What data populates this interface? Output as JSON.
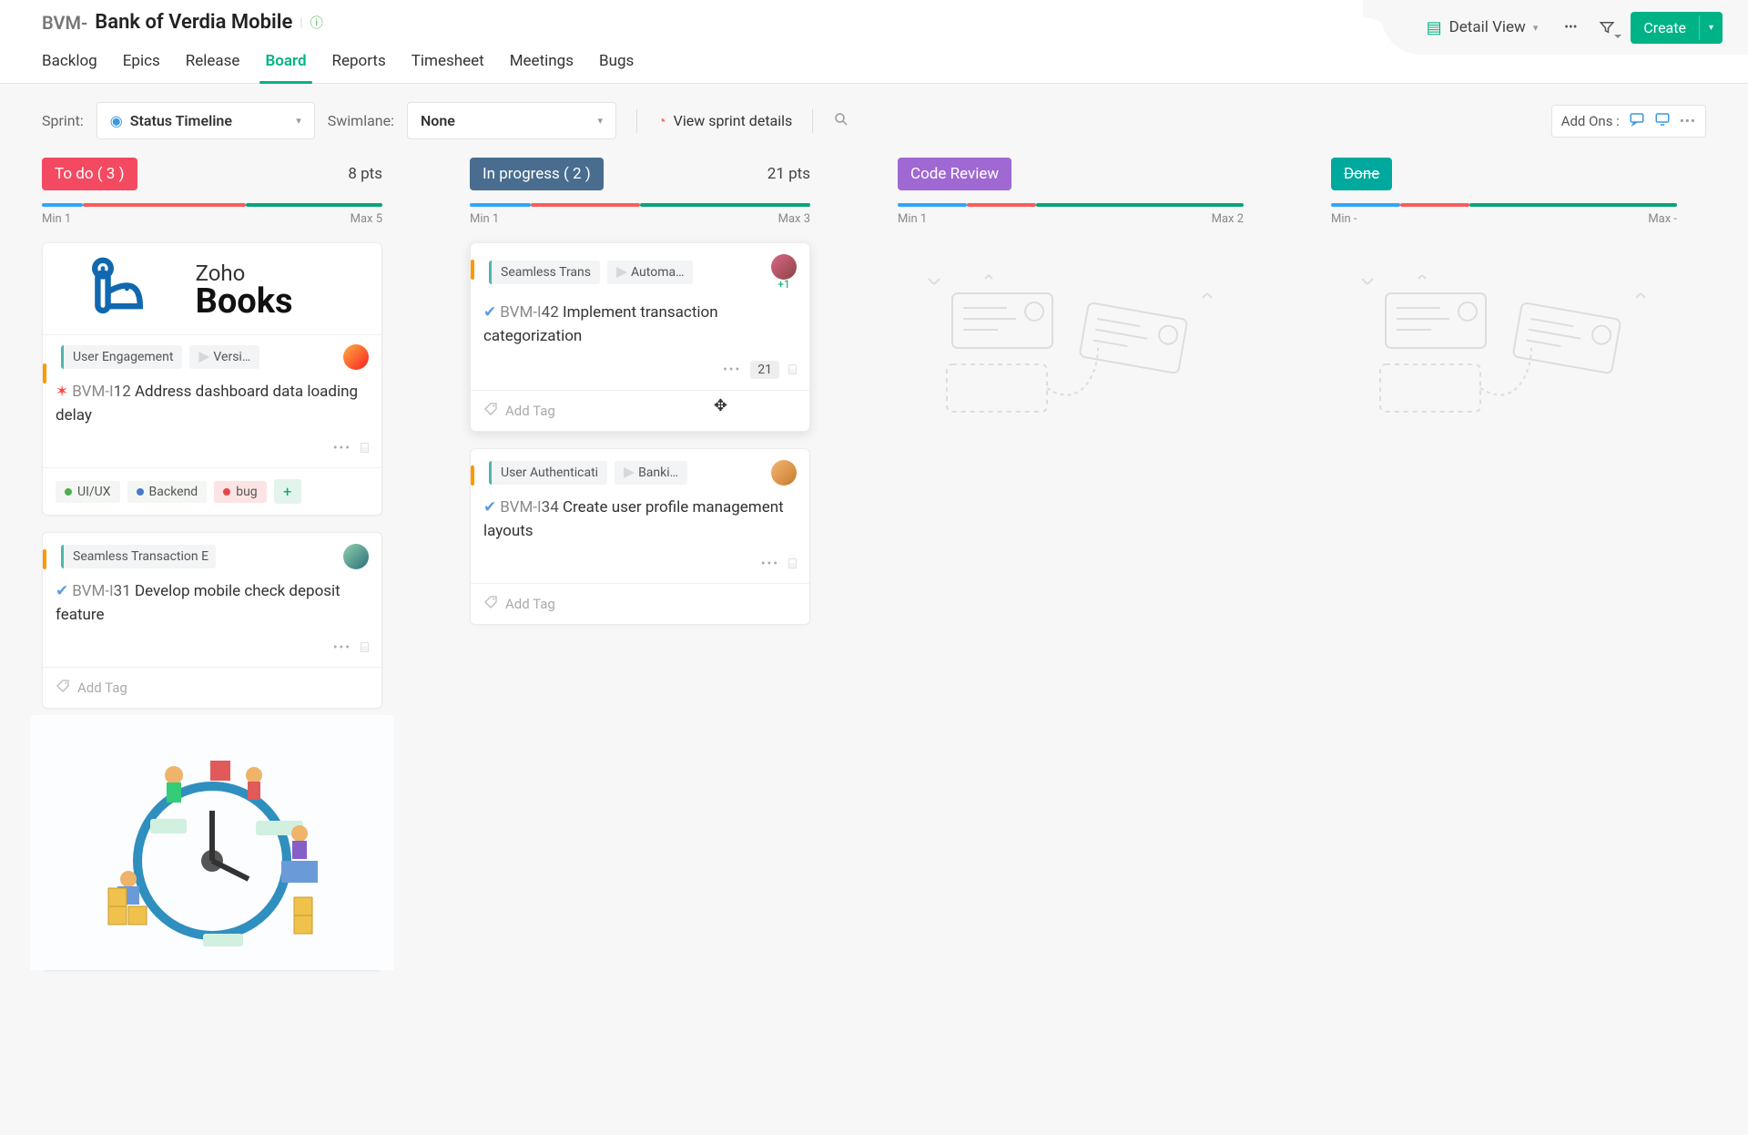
{
  "header": {
    "project_prefix": "BVM-",
    "project_name": "Bank of Verdia Mobile",
    "nav": [
      "Backlog",
      "Epics",
      "Release",
      "Board",
      "Reports",
      "Timesheet",
      "Meetings",
      "Bugs"
    ],
    "active_nav_index": 3,
    "detail_view_label": "Detail View",
    "create_label": "Create"
  },
  "toolbar": {
    "sprint_label": "Sprint:",
    "sprint_value": "Status Timeline",
    "swimlane_label": "Swimlane:",
    "swimlane_value": "None",
    "view_sprint": "View sprint details",
    "addons_label": "Add Ons :"
  },
  "columns": [
    {
      "name": "To do",
      "count": 3,
      "points": "8 pts",
      "pill_class": "pill-red",
      "wip_segments": [
        {
          "w": "12%",
          "c": "#2fa6ff"
        },
        {
          "w": "48%",
          "c": "#ff5a5a"
        },
        {
          "w": "40%",
          "c": "#0aa57a"
        }
      ],
      "min": "Min 1",
      "max": "Max 5"
    },
    {
      "name": "In progress",
      "count": 2,
      "points": "21 pts",
      "pill_class": "pill-blue",
      "wip_segments": [
        {
          "w": "18%",
          "c": "#2fa6ff"
        },
        {
          "w": "32%",
          "c": "#ff5a5a"
        },
        {
          "w": "50%",
          "c": "#0aa57a"
        }
      ],
      "min": "Min 1",
      "max": "Max 3"
    },
    {
      "name": "Code Review",
      "count": null,
      "points": "",
      "pill_class": "pill-purple",
      "wip_segments": [
        {
          "w": "20%",
          "c": "#2fa6ff"
        },
        {
          "w": "20%",
          "c": "#ff5a5a"
        },
        {
          "w": "60%",
          "c": "#0aa57a"
        }
      ],
      "min": "Min 1",
      "max": "Max 2"
    },
    {
      "name": "Done",
      "count": null,
      "points": "",
      "pill_class": "pill-teal",
      "wip_segments": [
        {
          "w": "20%",
          "c": "#2fa6ff"
        },
        {
          "w": "20%",
          "c": "#ff5a5a"
        },
        {
          "w": "60%",
          "c": "#0aa57a"
        }
      ],
      "min": "Min -",
      "max": "Max -"
    }
  ],
  "cards_col1": [
    {
      "hero": "books",
      "chip1": "User Engagement",
      "chip2": "Versi…",
      "tid_pre": "BVM-I",
      "tid_num": "12",
      "title": "Address dashboard data loading delay",
      "type": "bug",
      "tags": [
        "UI/UX",
        "Backend",
        "bug"
      ]
    },
    {
      "chip1": "Seamless Transaction E",
      "tid_pre": "BVM-I",
      "tid_num": "31",
      "title": "Develop mobile check deposit feature",
      "type": "task",
      "add_tag": "Add Tag"
    },
    {
      "hero": "illustration"
    }
  ],
  "cards_col2": [
    {
      "chip1": "Seamless Trans",
      "chip2": "Automa…",
      "plus": "+1",
      "tid_pre": "BVM-I",
      "tid_num": "42",
      "title": "Implement transaction categorization",
      "type": "task",
      "points": "21",
      "add_tag": "Add Tag",
      "shadowed": true
    },
    {
      "chip1": "User Authenticati",
      "chip2": "Banki…",
      "tid_pre": "BVM-I",
      "tid_num": "34",
      "title": "Create user profile management layouts",
      "type": "task",
      "add_tag": "Add Tag"
    }
  ]
}
